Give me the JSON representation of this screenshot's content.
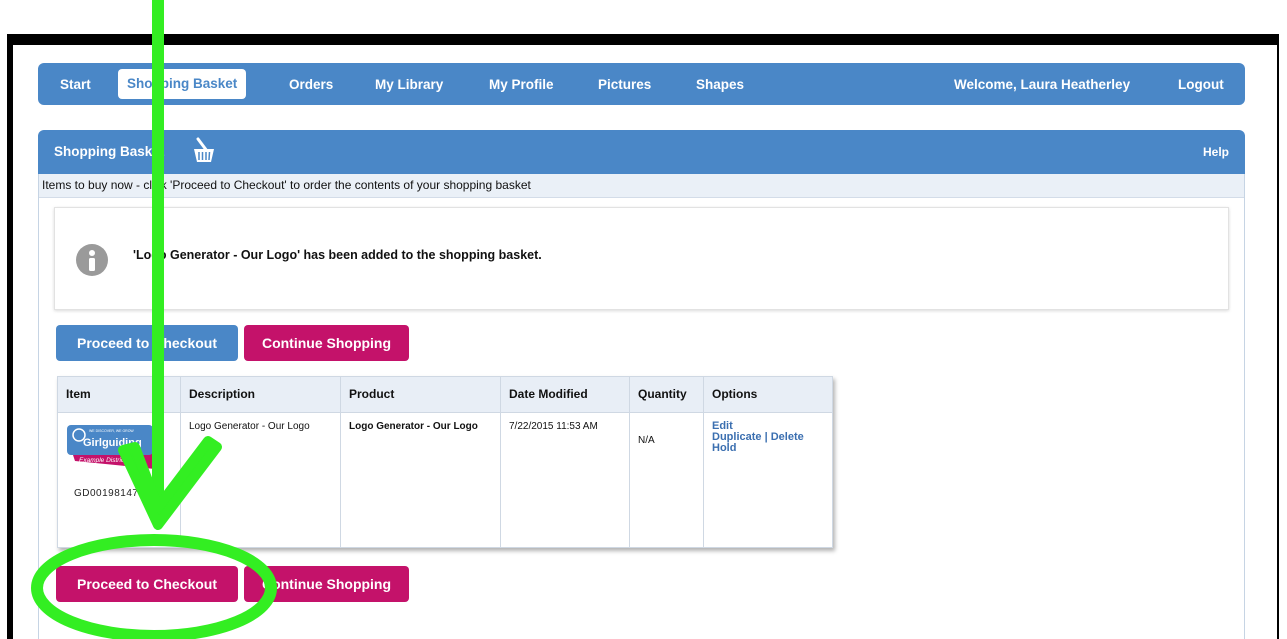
{
  "nav": {
    "items": [
      "Start",
      "Shopping Basket",
      "Orders",
      "My Library",
      "My Profile",
      "Pictures",
      "Shapes"
    ],
    "welcome": "Welcome, Laura Heatherley",
    "logout": "Logout"
  },
  "panel": {
    "title": "Shopping Basket",
    "help": "Help",
    "instructions": "Items to buy now - click 'Proceed to Checkout' to order the contents of your shopping basket"
  },
  "notice": {
    "message": "'Logo Generator - Our Logo' has been added to the shopping basket."
  },
  "buttons": {
    "proceed": "Proceed to Checkout",
    "continue": "Continue Shopping"
  },
  "table": {
    "headers": [
      "Item",
      "Description",
      "Product",
      "Date Modified",
      "Quantity",
      "Options"
    ],
    "rows": [
      {
        "item_code": "GD00198147",
        "thumb_brand": "Girlguiding",
        "thumb_tagline": "WE DISCOVER, WE GROW",
        "thumb_district": "Example District",
        "description": "Logo Generator - Our Logo",
        "product": "Logo Generator - Our Logo",
        "date_modified": "7/22/2015 11:53 AM",
        "quantity": "N/A",
        "options": {
          "edit": "Edit",
          "duplicate": "Duplicate",
          "separator": "|",
          "delete": "Delete",
          "hold": "Hold"
        }
      }
    ]
  },
  "colors": {
    "nav_blue": "#4a87c7",
    "pink": "#c4126a",
    "annotation_green": "#33ee22"
  }
}
